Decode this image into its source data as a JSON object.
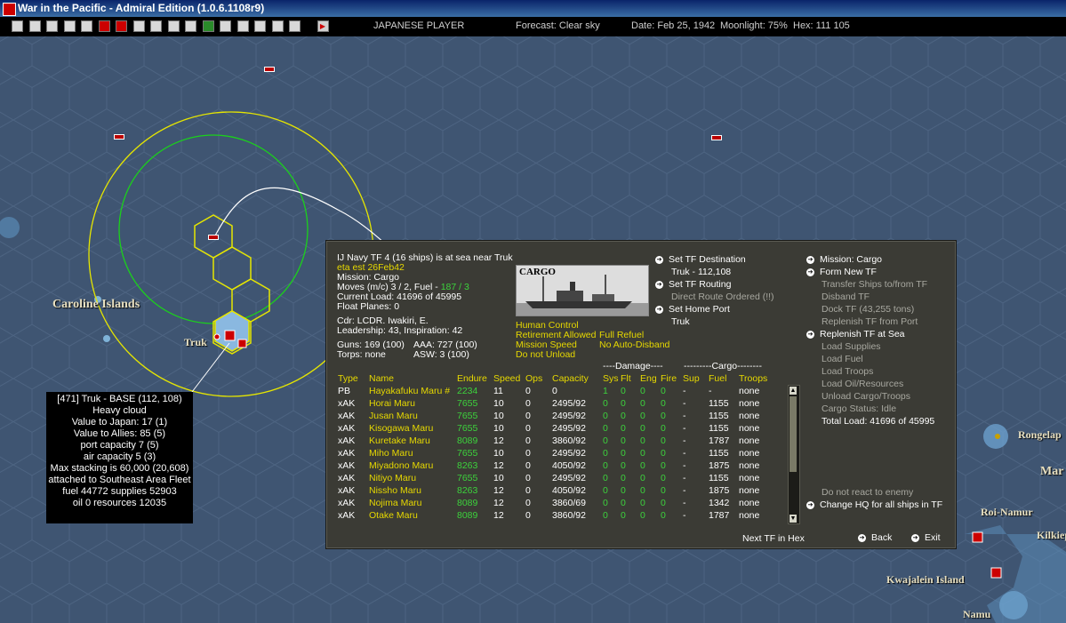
{
  "window": {
    "title": "War in the Pacific - Admiral Edition (1.0.6.1108r9)"
  },
  "toolbar": {
    "player": "JAPANESE PLAYER",
    "forecast": "Forecast: Clear sky",
    "date": "Date: Feb 25, 1942",
    "moonlight": "Moonlight: 75%",
    "hex": "Hex: 111  105",
    "buttons": [
      "info-icon",
      "report-icon",
      "base-icon",
      "ship-icon",
      "intel-icon",
      "flag-icon",
      "plane-icon",
      "unit-icon",
      "anchor-icon",
      "sub-icon",
      "map-icon",
      "land-icon",
      "fleet-icon",
      "cycle-icon",
      "op-icon",
      "save-icon",
      "disk-icon",
      "end-turn-icon"
    ]
  },
  "map": {
    "labels": {
      "caroline": "Caroline Islands",
      "truk": "Truk",
      "roi": "Roi-Namur",
      "kwaj": "Kwajalein Island",
      "namu": "Namu",
      "rongelap": "Rongelap",
      "kiliep": "Kilkiep",
      "mar": "Mar"
    }
  },
  "tooltip": {
    "lines": [
      "[471] Truk  - BASE (112, 108)",
      "Heavy cloud",
      "Value to Japan: 17 (1)",
      "Value to Allies: 85 (5)",
      "port capacity 7 (5)",
      "air capacity 5 (3)",
      "Max stacking is 60,000 (20,608)",
      "attached to Southeast Area Fleet",
      "fuel 44772  supplies 52903",
      "oil 0  resources 12035"
    ]
  },
  "panel": {
    "tf_title": "IJ Navy TF 4 (16 ships) is at sea near Truk",
    "eta": "eta est 26Feb42",
    "mission": "Mission: Cargo",
    "moves": "Moves (m/c) 3 / 2, Fuel - ",
    "moves_fuel": "187 / 3",
    "load": "Current Load: 41696 of 45995",
    "float_planes": "Float Planes: 0",
    "cdr": "Cdr: LCDR. Iwakiri, E.",
    "leadership": "Leadership: 43, Inspiration: 42",
    "guns": "Guns: 169 (100)",
    "aaa": "AAA: 727 (100)",
    "torps": "Torps: none",
    "asw": "ASW: 3 (100)",
    "ship_type_label": "CARGO",
    "human_control": "Human Control",
    "retirement": "Retirement Allowed",
    "full_refuel": "Full Refuel",
    "mission_speed": "Mission Speed",
    "no_auto_disband": "No Auto-Disband",
    "do_not_unload": "Do not Unload",
    "set_destination": "Set TF Destination",
    "destination_value": "Truk - 112,108",
    "set_routing": "Set TF Routing",
    "routing_value": "Direct Route Ordered (!!)",
    "set_home": "Set Home Port",
    "home_value": "Truk",
    "right_menu": {
      "mission": "Mission: Cargo",
      "form_new": "Form New TF",
      "transfer": "Transfer Ships to/from TF",
      "disband": "Disband TF",
      "dock": "Dock TF (43,255 tons)",
      "replenish_port": "Replenish TF from Port",
      "replenish_sea": "Replenish TF at Sea",
      "load_supplies": "Load Supplies",
      "load_fuel": "Load Fuel",
      "load_troops": "Load Troops",
      "load_oil": "Load Oil/Resources",
      "unload": "Unload Cargo/Troops",
      "cargo_status": "Cargo Status: Idle",
      "total_load": "Total Load: 41696 of 45995",
      "no_react": "Do not react to enemy",
      "change_hq": "Change HQ for all ships in TF"
    },
    "group_damage": "----Damage----",
    "group_cargo": "---------Cargo--------",
    "headers": [
      "Type",
      "Name",
      "Endure",
      "Speed",
      "Ops",
      "Capacity",
      "Sys",
      "Flt",
      "Eng",
      "Fire",
      "Sup",
      "Fuel",
      "Troops"
    ],
    "ships": [
      [
        "PB",
        "Hayakafuku Maru #",
        "2234",
        "11",
        "0",
        "0",
        "1",
        "0",
        "0",
        "0",
        "-",
        "-",
        "none"
      ],
      [
        "xAK",
        "Horai Maru",
        "7655",
        "10",
        "0",
        "2495/92",
        "0",
        "0",
        "0",
        "0",
        "-",
        "1155",
        "none"
      ],
      [
        "xAK",
        "Jusan Maru",
        "7655",
        "10",
        "0",
        "2495/92",
        "0",
        "0",
        "0",
        "0",
        "-",
        "1155",
        "none"
      ],
      [
        "xAK",
        "Kisogawa Maru",
        "7655",
        "10",
        "0",
        "2495/92",
        "0",
        "0",
        "0",
        "0",
        "-",
        "1155",
        "none"
      ],
      [
        "xAK",
        "Kuretake Maru",
        "8089",
        "12",
        "0",
        "3860/92",
        "0",
        "0",
        "0",
        "0",
        "-",
        "1787",
        "none"
      ],
      [
        "xAK",
        "Miho Maru",
        "7655",
        "10",
        "0",
        "2495/92",
        "0",
        "0",
        "0",
        "0",
        "-",
        "1155",
        "none"
      ],
      [
        "xAK",
        "Miyadono Maru",
        "8263",
        "12",
        "0",
        "4050/92",
        "0",
        "0",
        "0",
        "0",
        "-",
        "1875",
        "none"
      ],
      [
        "xAK",
        "Nitiyo Maru",
        "7655",
        "10",
        "0",
        "2495/92",
        "0",
        "0",
        "0",
        "0",
        "-",
        "1155",
        "none"
      ],
      [
        "xAK",
        "Nissho Maru",
        "8263",
        "12",
        "0",
        "4050/92",
        "0",
        "0",
        "0",
        "0",
        "-",
        "1875",
        "none"
      ],
      [
        "xAK",
        "Nojima Maru",
        "8089",
        "12",
        "0",
        "3860/69",
        "0",
        "0",
        "0",
        "0",
        "-",
        "1342",
        "none"
      ],
      [
        "xAK",
        "Otake Maru",
        "8089",
        "12",
        "0",
        "3860/92",
        "0",
        "0",
        "0",
        "0",
        "-",
        "1787",
        "none"
      ]
    ],
    "next_tf": "Next TF in Hex",
    "back": "Back",
    "exit": "Exit"
  }
}
